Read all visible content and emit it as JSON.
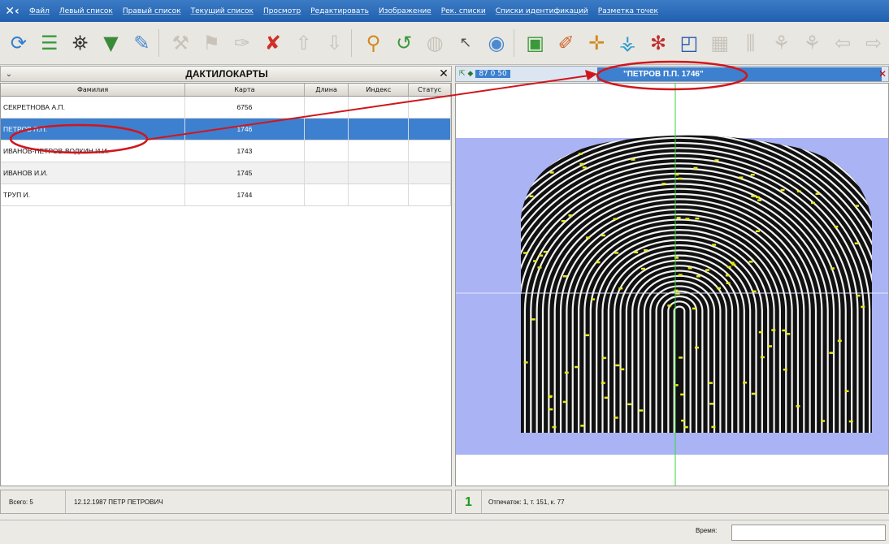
{
  "menu": [
    "Файл",
    "Левый список",
    "Правый список",
    "Текущий список",
    "Просмотр",
    "Редактировать",
    "Изображение",
    "Рек. списки",
    "Списки идентификаций",
    "Разметка точек"
  ],
  "left_panel": {
    "title": "ДАКТИЛОКАРТЫ",
    "columns": [
      "Фамилия",
      "Карта",
      "Длина",
      "Индекс",
      "Статус"
    ],
    "rows": [
      {
        "name": "СЕКРЕТНОВА А.П.",
        "card": "6756"
      },
      {
        "name": "ПЕТРОВ П.П.",
        "card": "1746"
      },
      {
        "name": "ИВАНОВ-ПЕТРОВ-ВОДКИН И.И.",
        "card": "1743"
      },
      {
        "name": "ИВАНОВ И.И.",
        "card": "1745"
      },
      {
        "name": "ТРУП И.",
        "card": "1744"
      }
    ],
    "status_count": "Всего: 5",
    "status_info": "12.12.1987 ПЕТР ПЕТРОВИЧ"
  },
  "right_panel": {
    "header_icons": "87 0 50",
    "image_title": "\"ПЕТРОВ П.П. 1746\"",
    "status_num": "1",
    "status_info": "Отпечаток: 1, т. 151, к. 77"
  },
  "bottom": {
    "time_label": "Время:"
  },
  "colors": {
    "selection": "#3d80cf",
    "menubar": "#2a6cbc",
    "annotation": "#d0161c",
    "minutiae": "#e6e81a",
    "fingerprint_bg": "#aab3f4"
  }
}
